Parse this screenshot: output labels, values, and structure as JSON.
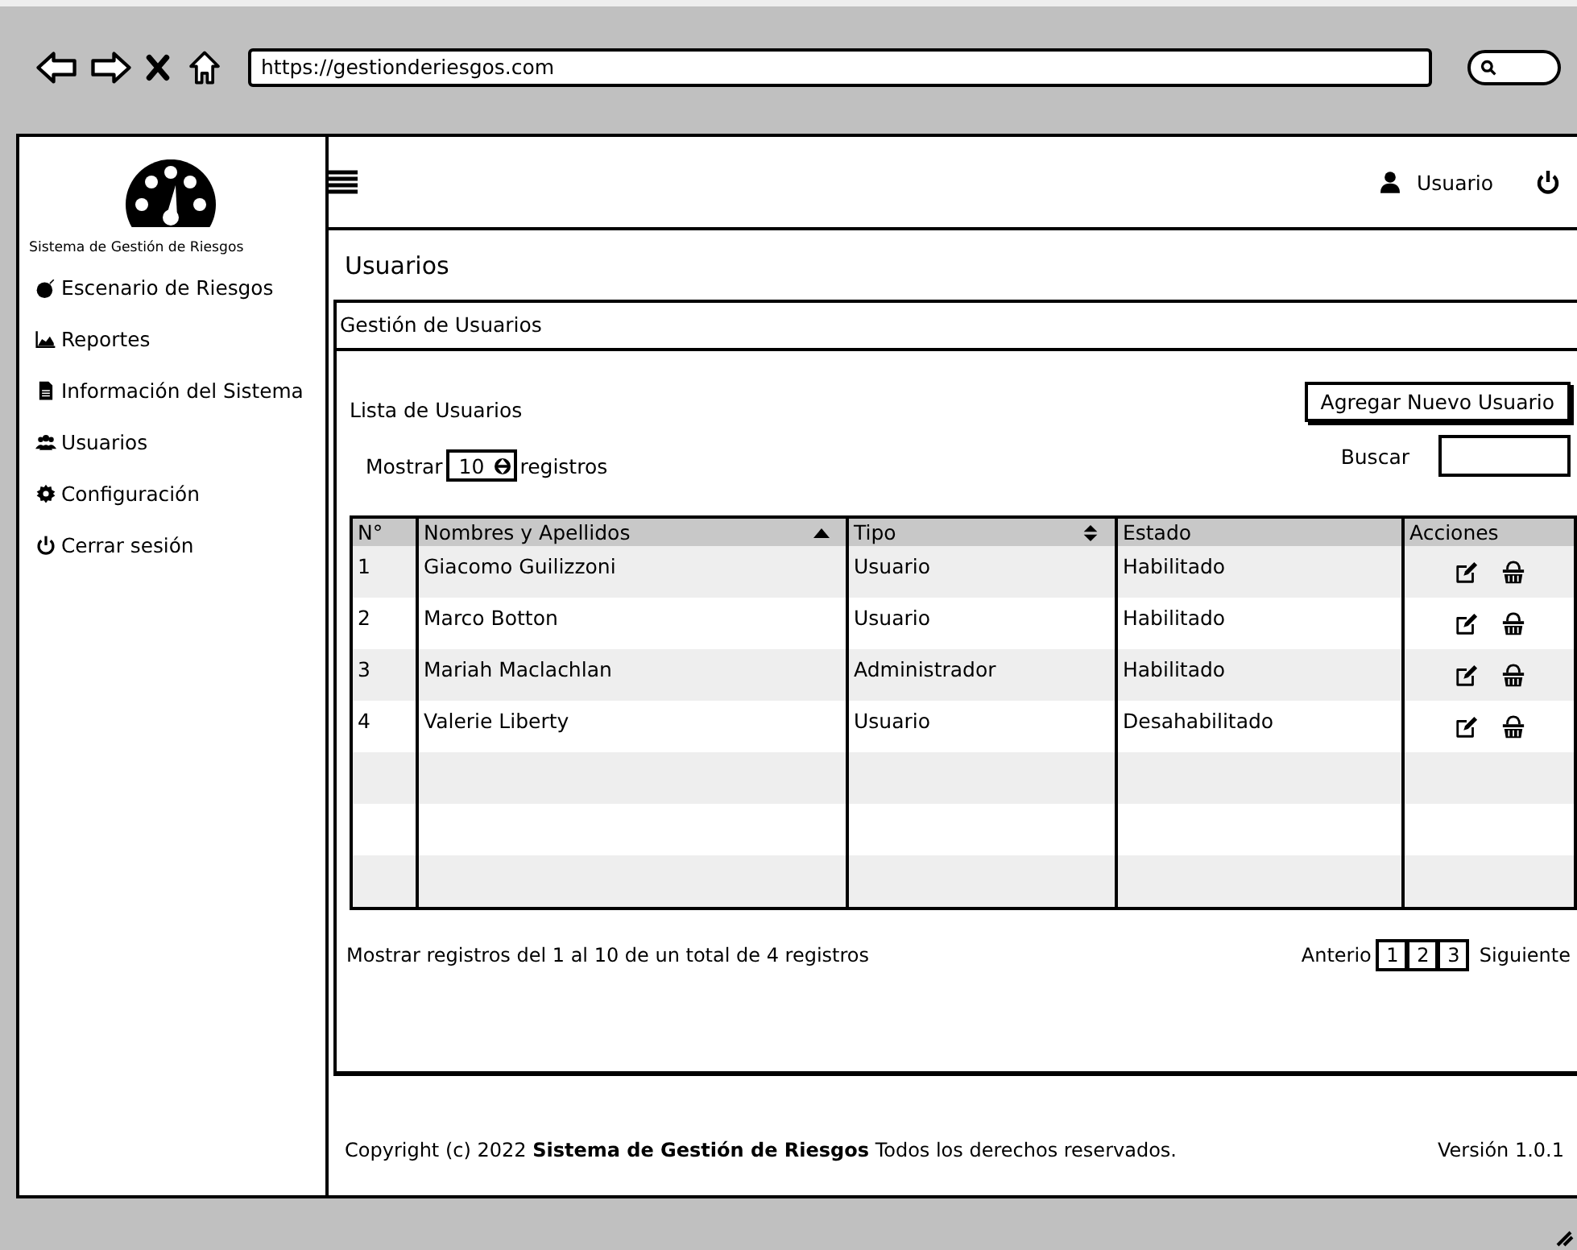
{
  "browser": {
    "url": "https://gestionderiesgos.com"
  },
  "sidebar": {
    "brand": "Sistema de Gestión de Riesgos",
    "items": [
      {
        "label": "Escenario de Riesgos"
      },
      {
        "label": "Reportes"
      },
      {
        "label": "Información del Sistema"
      },
      {
        "label": "Usuarios"
      },
      {
        "label": "Configuración"
      },
      {
        "label": "Cerrar sesión"
      }
    ]
  },
  "topbar": {
    "user": "Usuario"
  },
  "page_title": "Usuarios",
  "panel": {
    "title": "Gestión de Usuarios",
    "list_title": "Lista de Usuarios",
    "add_button": "Agregar Nuevo Usuario",
    "show_label": "Mostrar",
    "show_value": "10",
    "show_suffix": "registros",
    "search_label": "Buscar",
    "table": {
      "columns": [
        "N°",
        "Nombres y Apellidos",
        "Tipo",
        "Estado",
        "Acciones"
      ],
      "rows": [
        {
          "n": "1",
          "name": "Giacomo Guilizzoni",
          "type": "Usuario",
          "status": "Habilitado"
        },
        {
          "n": "2",
          "name": "Marco Botton",
          "type": "Usuario",
          "status": "Habilitado"
        },
        {
          "n": "3",
          "name": "Mariah Maclachlan",
          "type": "Administrador",
          "status": "Habilitado"
        },
        {
          "n": "4",
          "name": "Valerie Liberty",
          "type": "Usuario",
          "status": "Desahabilitado"
        }
      ]
    },
    "summary": "Mostrar registros del 1 al 10 de un total de 4 registros",
    "pagination": {
      "previous": "Anterio",
      "pages": [
        "1",
        "2",
        "3"
      ],
      "next": "Siguiente"
    }
  },
  "footer": {
    "copyright": "Copyright (c) 2022  **Sistema de Gestión de Riesgos**  Todos los derechos reservados.",
    "version": "Versión 1.0.1"
  }
}
